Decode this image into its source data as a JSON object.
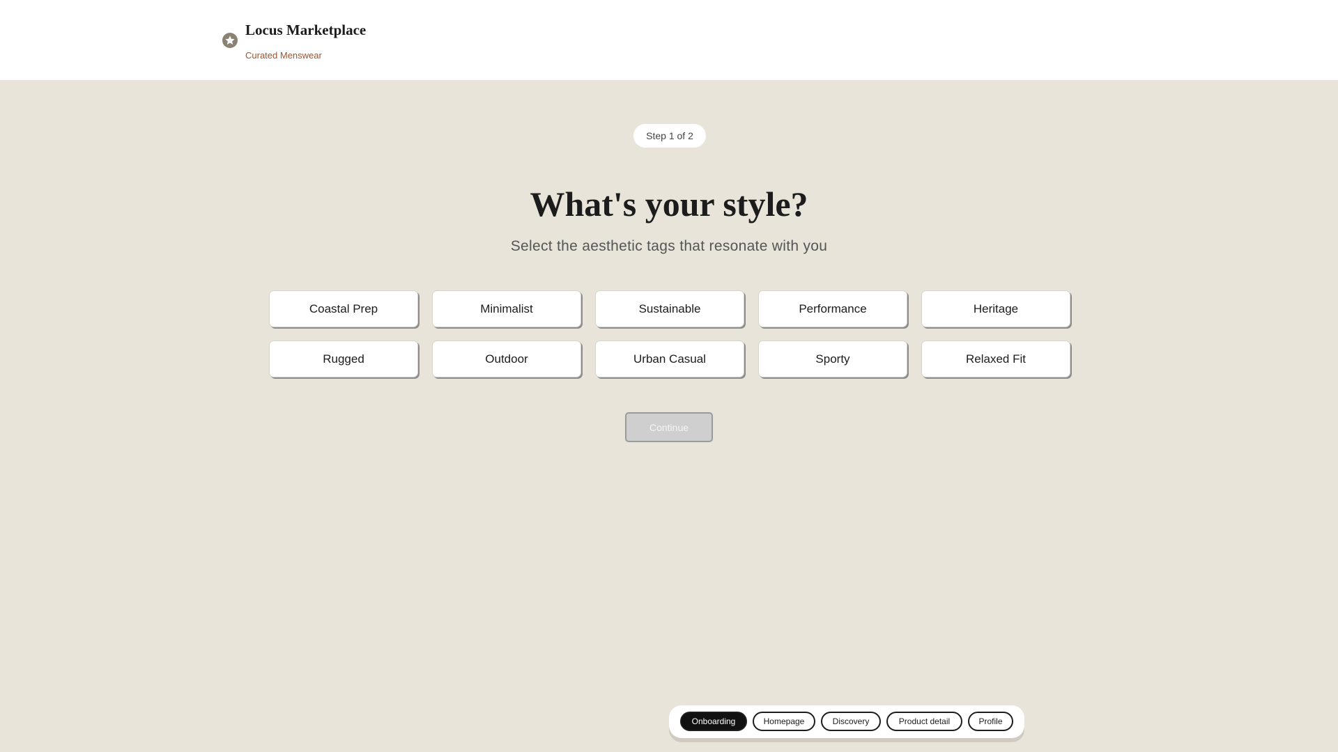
{
  "header": {
    "brand_title": "Locus Marketplace",
    "brand_subtitle": "Curated Menswear",
    "brand_icon": "star-badge-icon"
  },
  "onboarding": {
    "step_label": "Step 1 of 2",
    "title": "What's your style?",
    "subtitle": "Select the aesthetic tags that resonate with you",
    "tags": [
      "Coastal Prep",
      "Minimalist",
      "Sustainable",
      "Performance",
      "Heritage",
      "Rugged",
      "Outdoor",
      "Urban Casual",
      "Sporty",
      "Relaxed Fit"
    ],
    "continue_label": "Continue",
    "continue_disabled": true
  },
  "nav": {
    "items": [
      "Onboarding",
      "Homepage",
      "Discovery",
      "Product detail",
      "Profile"
    ],
    "active": "Onboarding"
  },
  "colors": {
    "background": "#e8e4da",
    "accent": "#a0522d",
    "active_nav": "#111111"
  }
}
